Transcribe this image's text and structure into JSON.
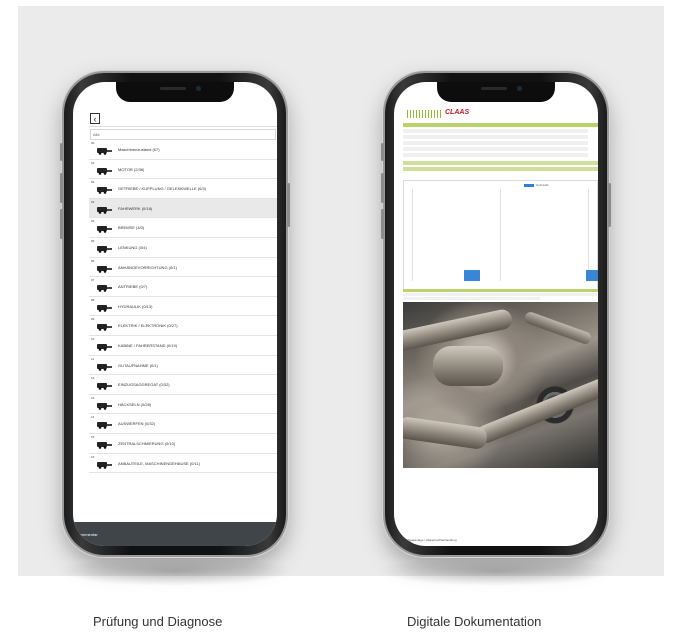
{
  "left_screen": {
    "search_value": "Alle",
    "items": [
      {
        "num": "00",
        "label": "Maschinenzustand (67)",
        "icon": "machine-icon"
      },
      {
        "num": "01",
        "label": "MOTOR (2/36)",
        "icon": "engine-icon"
      },
      {
        "num": "02",
        "label": "GETRIEBE / KUPPLUNG / GELENKWELLE (6/3)",
        "icon": "gearbox-icon"
      },
      {
        "num": "03",
        "label": "FAHRWERK (0/18)",
        "icon": "chassis-icon"
      },
      {
        "num": "04",
        "label": "BREMSE (4/0)",
        "icon": "brake-icon"
      },
      {
        "num": "05",
        "label": "LENKUNG (3/4)",
        "icon": "steering-icon"
      },
      {
        "num": "06",
        "label": "ANHÄNGEVORRICHTUNG (0/1)",
        "icon": "hitch-icon"
      },
      {
        "num": "07",
        "label": "ANTRIEBE (0/7)",
        "icon": "drive-icon"
      },
      {
        "num": "08",
        "label": "HYDRAULIK (0/13)",
        "icon": "hydraulic-icon"
      },
      {
        "num": "09",
        "label": "ELEKTRIK / ELEKTRONIK (0/27)",
        "icon": "electric-icon"
      },
      {
        "num": "10",
        "label": "KABINE / FAHRERSTAND (0/19)",
        "icon": "cab-icon"
      },
      {
        "num": "11",
        "label": "GUTAUFNAHME (0/1)",
        "icon": "intake-icon"
      },
      {
        "num": "12",
        "label": "EINZUGSAGGREGAT (0/32)",
        "icon": "feeder-icon"
      },
      {
        "num": "13",
        "label": "HÄCKSELN (0/28)",
        "icon": "chopper-icon"
      },
      {
        "num": "14",
        "label": "AUSWERFEN (0/32)",
        "icon": "spout-icon"
      },
      {
        "num": "15",
        "label": "ZENTRALSCHMIERUNG (0/10)",
        "icon": "lubrication-icon"
      },
      {
        "num": "16",
        "label": "ANBAUTEILE, MASCHINENGEHÄUSE (0/11)",
        "icon": "housing-icon"
      }
    ],
    "footer_label": "Kommentar"
  },
  "right_screen": {
    "brand": "CLAAS",
    "legend_label": "Hydraulik",
    "caption": "Abgasanlage / Abgasnachbehandlung"
  },
  "captions": {
    "left": "Prüfung und Diagnose",
    "right": "Digitale Dokumentation"
  },
  "colors": {
    "panel_bg": "#ebebeb",
    "footer_bar": "#3f4549",
    "brand_red": "#c4161c",
    "brand_green": "#8fbe2a",
    "chart_bar": "#3a86d6"
  }
}
